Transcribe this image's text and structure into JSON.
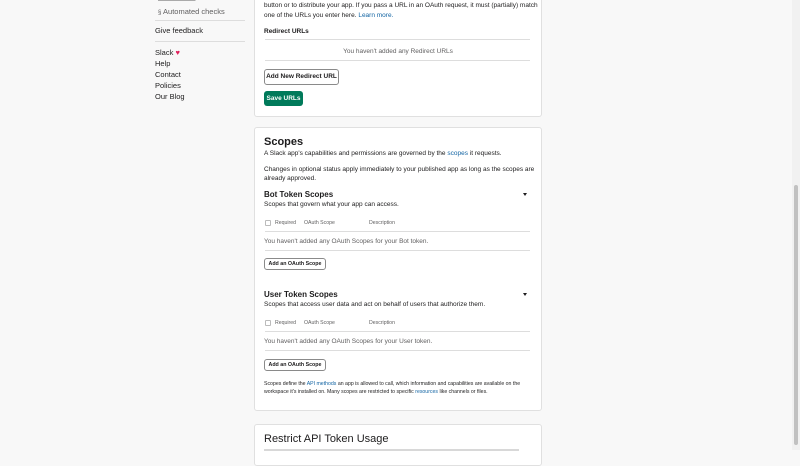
{
  "sidebar": {
    "sub_item": "Automated checks",
    "give_feedback": "Give feedback",
    "slack": "Slack",
    "heart": "♥",
    "help": "Help",
    "contact": "Contact",
    "policies": "Policies",
    "our_blog": "Our Blog"
  },
  "redirect": {
    "desc_line1": "button or to distribute your app. If you pass a URL in an OAuth request, it must (partially) match",
    "desc_line2a": "one of the URLs you enter here.",
    "learn_more": "Learn more.",
    "urls_title": "Redirect URLs",
    "empty": "You haven't added any Redirect URLs",
    "add_button": "Add New Redirect URL",
    "save_button": "Save URLs"
  },
  "scopes": {
    "title": "Scopes",
    "desc_a": "A Slack app's capabilities and permissions are governed by the",
    "desc_link": "scopes",
    "desc_b": "it requests.",
    "changes_line1": "Changes in optional status apply immediately to your published app as long as the scopes are",
    "changes_line2": "already approved.",
    "bot": {
      "title": "Bot Token Scopes",
      "subtitle": "Scopes that govern what your app can access.",
      "col_required": "Required",
      "col_scope": "OAuth Scope",
      "col_description": "Description",
      "empty": "You haven't added any OAuth Scopes for your Bot token.",
      "add_button": "Add an OAuth Scope"
    },
    "user": {
      "title": "User Token Scopes",
      "subtitle": "Scopes that access user data and act on behalf of users that authorize them.",
      "col_required": "Required",
      "col_scope": "OAuth Scope",
      "col_description": "Description",
      "empty": "You haven't added any OAuth Scopes for your User token.",
      "add_button": "Add an OAuth Scope"
    },
    "footer": {
      "a": "Scopes define the",
      "link1": "API methods",
      "b": "an app is allowed to call, which information and capabilities are available on the",
      "c": "workspace it's installed on. Many scopes are restricted to specific",
      "link2": "resources",
      "d": "like channels or files."
    }
  },
  "restrict": {
    "title": "Restrict API Token Usage"
  }
}
